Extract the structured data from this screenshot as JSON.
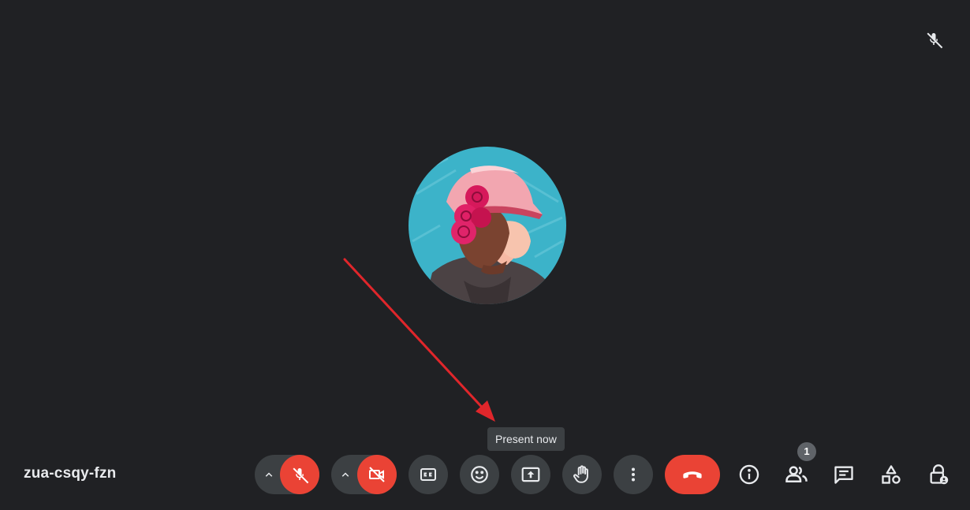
{
  "meeting": {
    "code": "zua-csqy-fzn"
  },
  "tooltip": {
    "text": "Present now"
  },
  "participants": {
    "count": "1"
  },
  "colors": {
    "background": "#202124",
    "button": "#3c4043",
    "danger": "#ea4335",
    "tooltip_bg": "#3c4043",
    "annotation_arrow": "#e0262b"
  },
  "icons": {
    "tile_status": "mic-off-icon",
    "controls": [
      "chevron-up-icon",
      "mic-off-icon",
      "chevron-up-icon",
      "videocam-off-icon",
      "closed-caption-icon",
      "emoji-icon",
      "present-now-icon",
      "raise-hand-icon",
      "more-options-icon",
      "call-end-icon"
    ],
    "side": [
      "info-icon",
      "people-icon",
      "chat-icon",
      "activities-icon",
      "host-controls-icon"
    ]
  }
}
